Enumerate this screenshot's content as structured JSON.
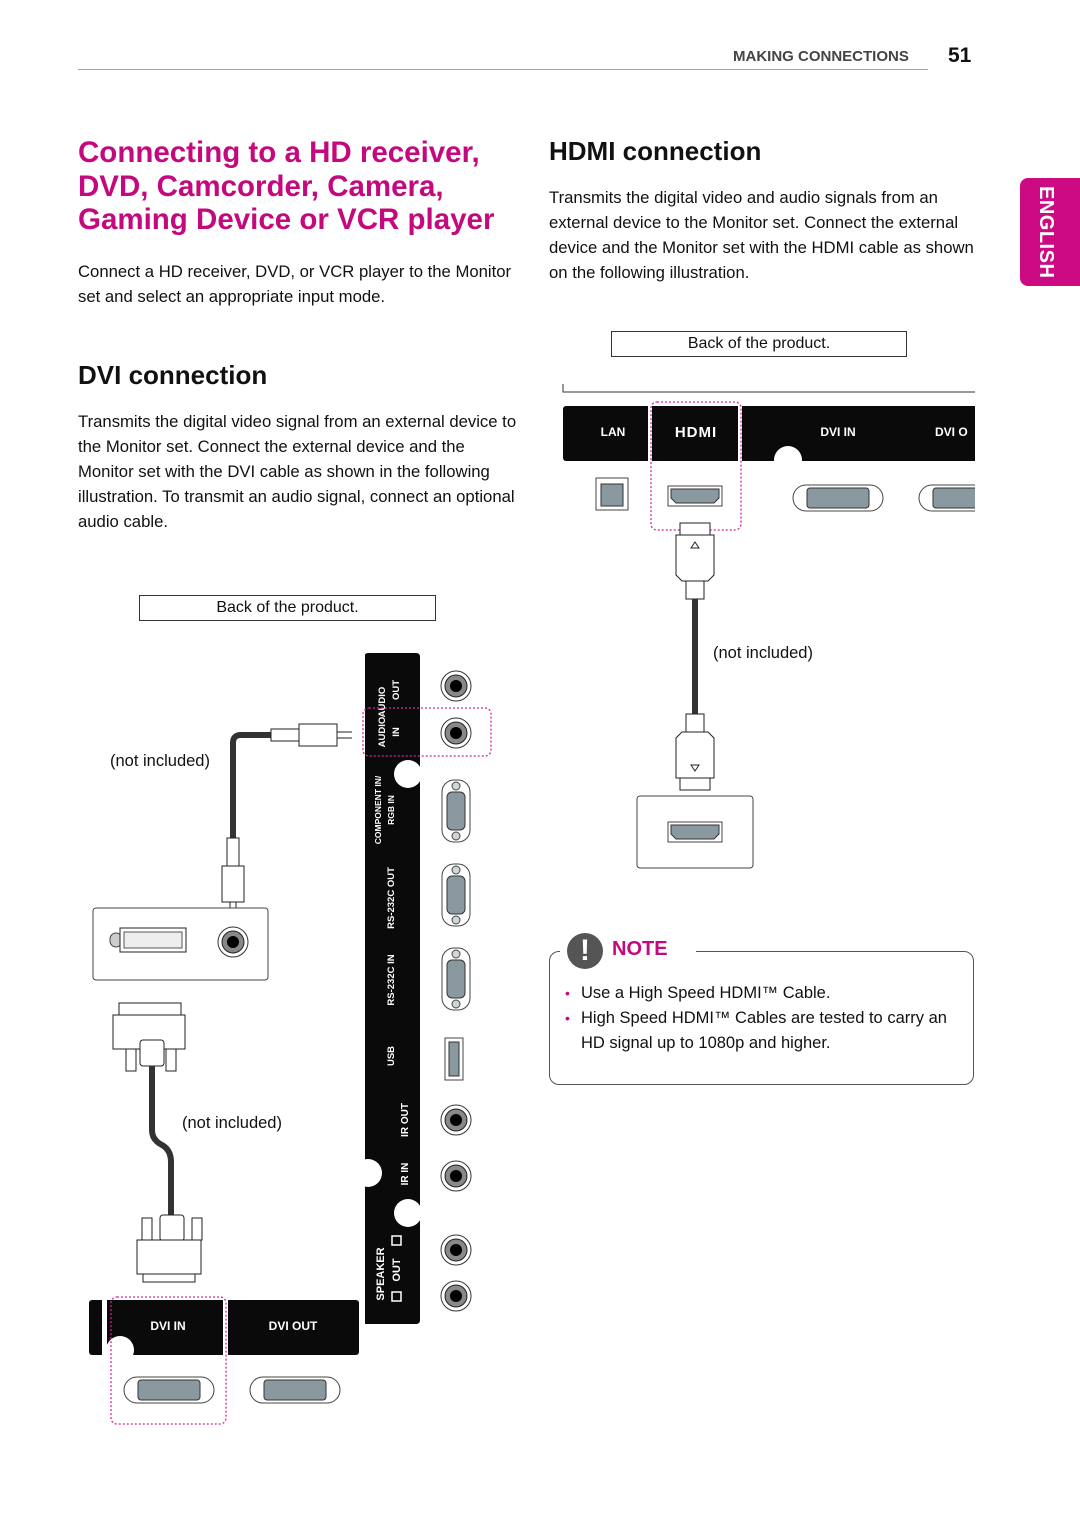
{
  "header": {
    "section": "MAKING CONNECTIONS",
    "page_number": "51"
  },
  "language_tab": "ENGLISH",
  "main": {
    "title": "Connecting to a HD receiver, DVD, Camcorder, Camera, Gaming Device or VCR player",
    "intro": "Connect a HD receiver, DVD, or VCR player to the Monitor set and select an appropriate input mode."
  },
  "dvi_section": {
    "heading": "DVI connection",
    "body": "Transmits the digital video signal from an external device to the Monitor set. Connect the external device and the Monitor set with the DVI cable as shown in the following illustration. To transmit an audio signal, connect an optional audio cable.",
    "caption": "Back of the product.",
    "audio_cable_label": "(not included)",
    "dvi_cable_label": "(not included)",
    "panel_ports_vertical": [
      "AUDIO OUT",
      "AUDIO IN",
      "COMPONENT IN/ RGB IN",
      "RS-232C OUT",
      "RS-232C IN",
      "USB",
      "IR OUT",
      "IR IN",
      "SPEAKER OUT"
    ],
    "panel_ports_bottom": [
      "DVI IN",
      "DVI OUT"
    ],
    "highlighted_ports": [
      "AUDIO IN",
      "DVI IN"
    ]
  },
  "hdmi_section": {
    "heading": "HDMI connection",
    "body": "Transmits the digital video and audio signals from an external device to the Monitor set. Connect the external device and the Monitor set with the HDMI cable as shown on the following illustration.",
    "caption": "Back of the product.",
    "cable_label": "(not included)",
    "panel_ports": [
      "LAN",
      "HDMI",
      "DVI IN",
      "DVI O"
    ],
    "highlighted_port": "HDMI"
  },
  "note": {
    "title": "NOTE",
    "icon": "exclamation-icon",
    "items": [
      "Use a High Speed HDMI™ Cable.",
      "High Speed HDMI™ Cables are tested to carry an HD signal up to 1080p and higher."
    ]
  },
  "colors": {
    "accent": "#c4087e",
    "panel": "#0a0a0a",
    "port_fill": "#8a98a0"
  }
}
